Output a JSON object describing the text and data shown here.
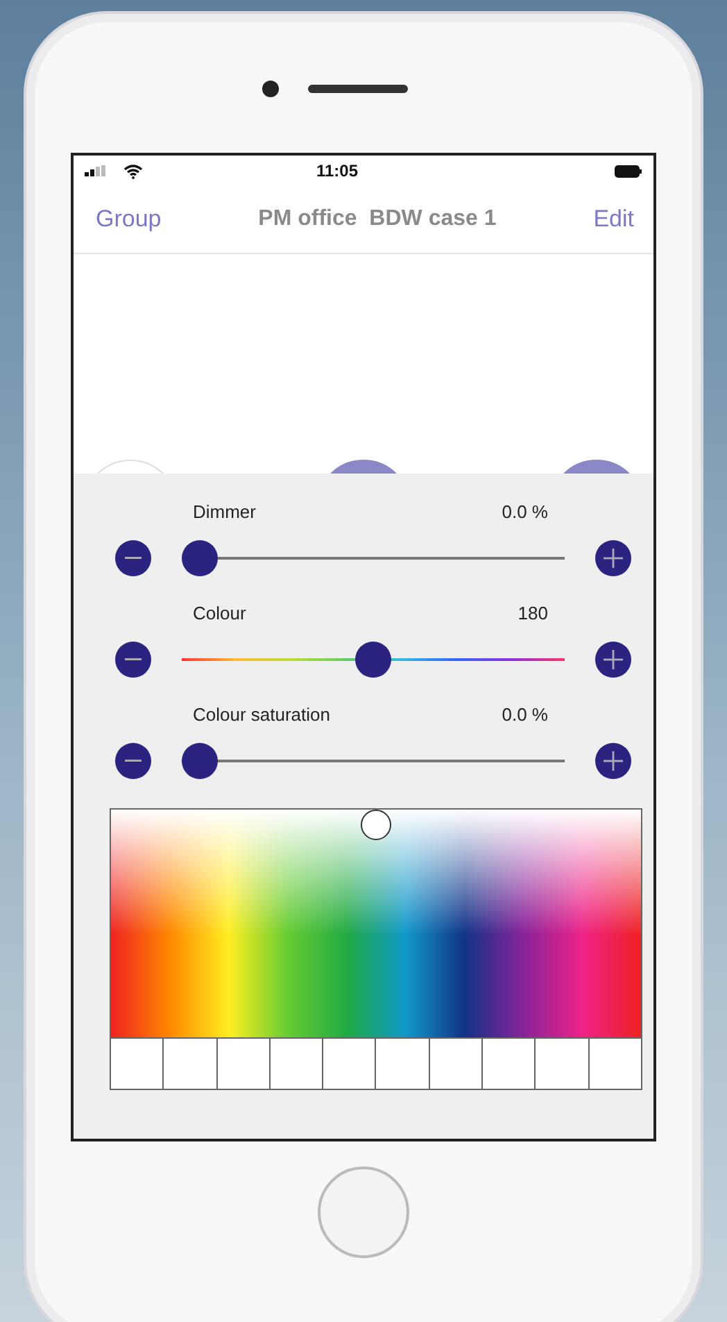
{
  "status_bar": {
    "time": "11:05"
  },
  "nav_bar": {
    "back": "Group",
    "title": "PM office  BDW case 1",
    "action": "Edit"
  },
  "scene_buttons": [
    {
      "selected": false
    },
    {
      "selected": true
    },
    {
      "selected": true
    }
  ],
  "sliders": [
    {
      "kind": "plain",
      "label": "Dimmer",
      "reading": "0.0 %",
      "level": 0
    },
    {
      "kind": "hue",
      "label": "Colour",
      "reading": "180",
      "level": 0.5
    },
    {
      "kind": "plain",
      "label": "Colour saturation",
      "reading": "0.0 %",
      "level": 0
    }
  ]
}
